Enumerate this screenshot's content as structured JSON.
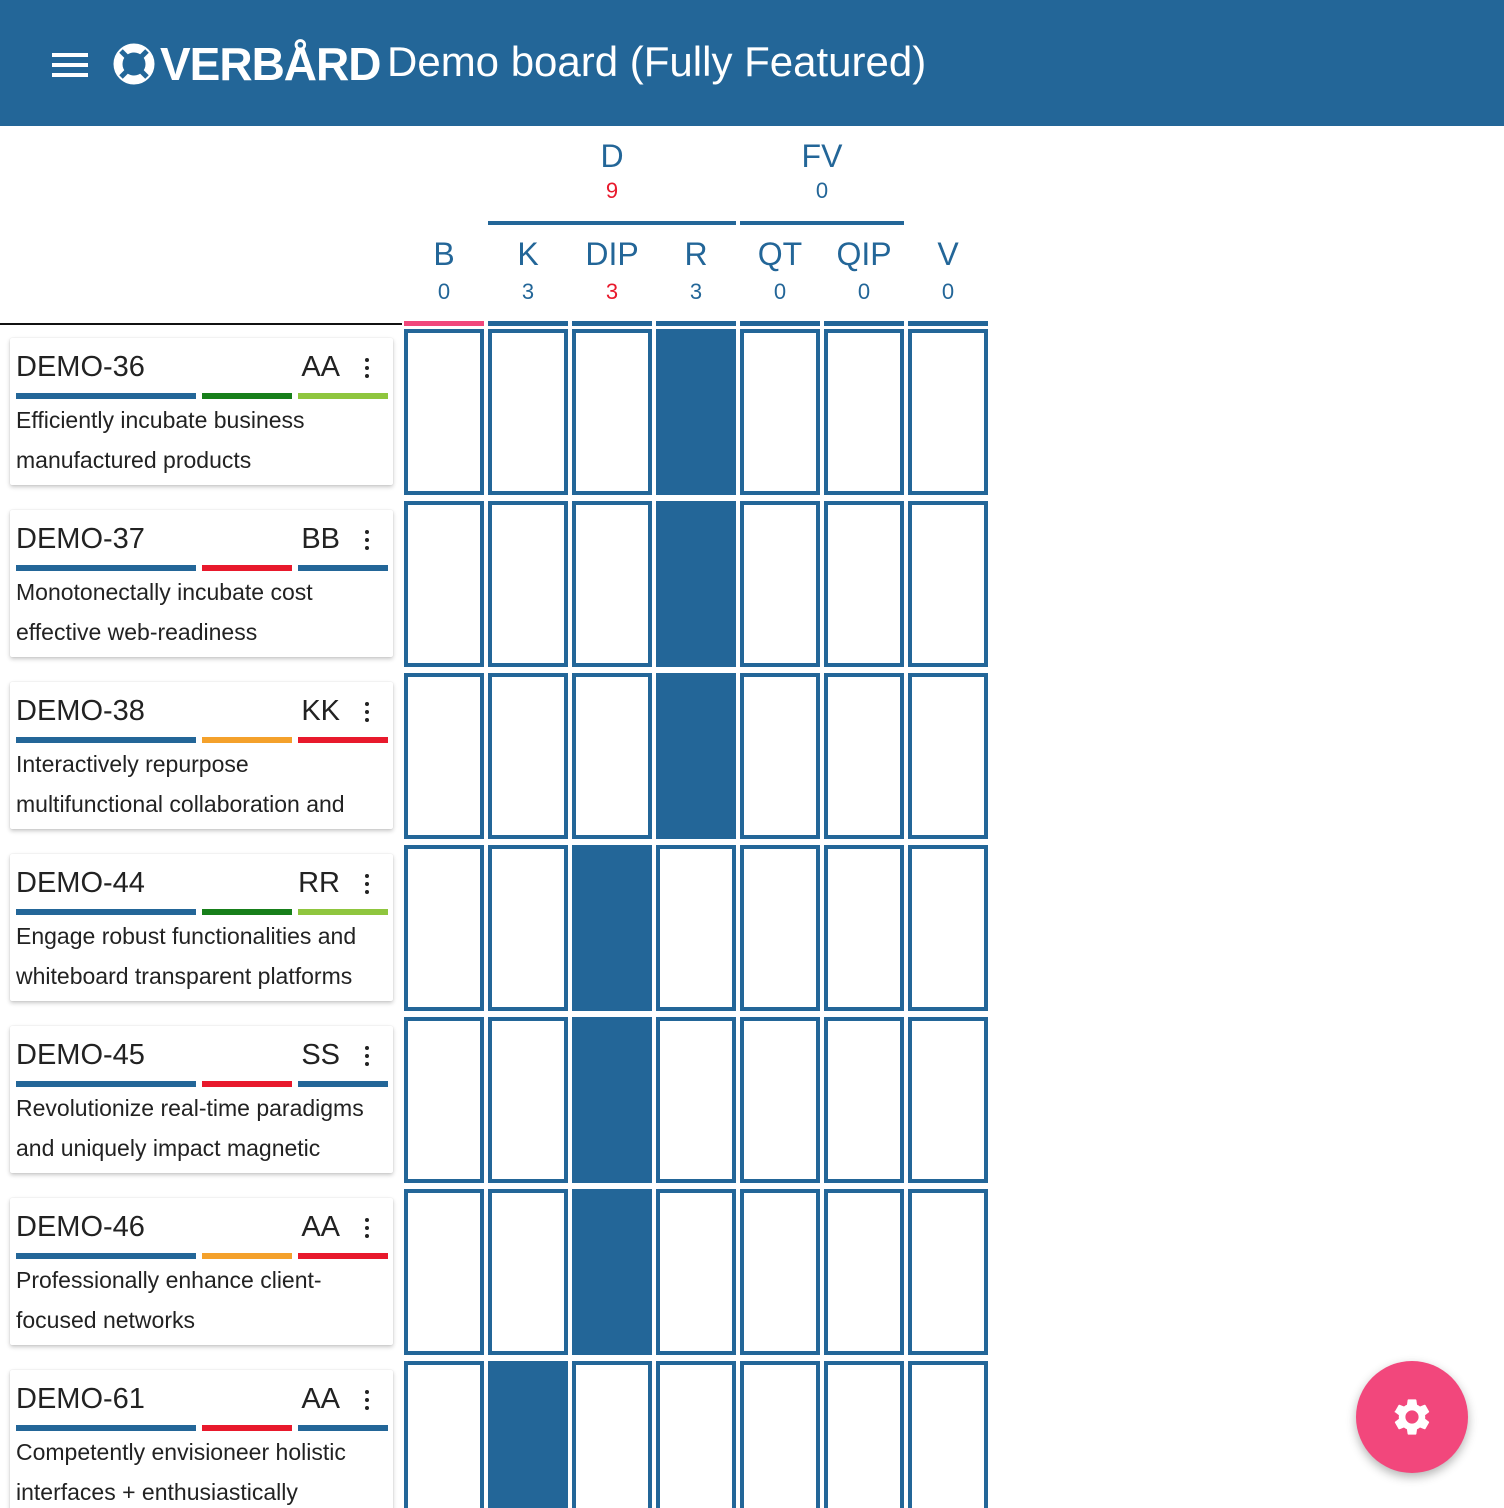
{
  "app": {
    "logo_text": "VERBÅRD",
    "board_title": "Demo board (Fully Featured)"
  },
  "groups": [
    {
      "name": "D",
      "count": "9",
      "count_over_limit": true
    },
    {
      "name": "FV",
      "count": "0",
      "count_over_limit": false
    }
  ],
  "columns": [
    {
      "name": "B",
      "count": "0",
      "over_limit": false
    },
    {
      "name": "K",
      "count": "3",
      "over_limit": false
    },
    {
      "name": "DIP",
      "count": "3",
      "over_limit": true
    },
    {
      "name": "R",
      "count": "3",
      "over_limit": false
    },
    {
      "name": "QT",
      "count": "0",
      "over_limit": false
    },
    {
      "name": "QIP",
      "count": "0",
      "over_limit": false
    },
    {
      "name": "V",
      "count": "0",
      "over_limit": false
    }
  ],
  "issues": [
    {
      "key": "DEMO-36",
      "assignee": "AA",
      "summary": "Efficiently incubate business manufactured products",
      "bar_colors": [
        "#236698",
        "#177f1a",
        "#8fc63e"
      ],
      "column_index": 3
    },
    {
      "key": "DEMO-37",
      "assignee": "BB",
      "summary": "Monotonectally incubate cost effective web-readiness",
      "bar_colors": [
        "#236698",
        "#e8192c",
        "#236698"
      ],
      "column_index": 3
    },
    {
      "key": "DEMO-38",
      "assignee": "KK",
      "summary": "Interactively repurpose multifunctional collaboration and",
      "bar_colors": [
        "#236698",
        "#f4a12b",
        "#e8192c"
      ],
      "column_index": 3
    },
    {
      "key": "DEMO-44",
      "assignee": "RR",
      "summary": "Engage robust functionalities and whiteboard transparent platforms",
      "bar_colors": [
        "#236698",
        "#177f1a",
        "#8fc63e"
      ],
      "column_index": 2
    },
    {
      "key": "DEMO-45",
      "assignee": "SS",
      "summary": "Revolutionize real-time paradigms and uniquely impact magnetic",
      "bar_colors": [
        "#236698",
        "#e8192c",
        "#236698"
      ],
      "column_index": 2
    },
    {
      "key": "DEMO-46",
      "assignee": "AA",
      "summary": "Professionally enhance client-focused networks",
      "bar_colors": [
        "#236698",
        "#f4a12b",
        "#e8192c"
      ],
      "column_index": 2
    },
    {
      "key": "DEMO-61",
      "assignee": "AA",
      "summary": "Competently envisioneer holistic interfaces + enthusiastically",
      "bar_colors": [
        "#236698",
        "#e8192c",
        "#236698"
      ],
      "column_index": 1
    }
  ],
  "colors": {
    "primary": "#236698",
    "accent": "#f2477c",
    "over_limit": "#e8192c"
  },
  "icons": {
    "menu": "menu-icon",
    "settings": "gear-icon",
    "card_menu": "more-vert-icon",
    "logo": "lifebuoy-icon"
  }
}
